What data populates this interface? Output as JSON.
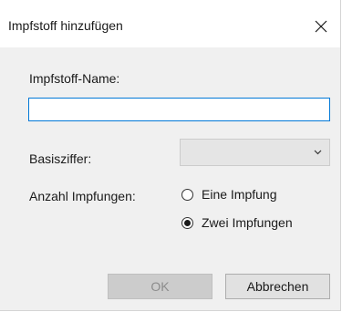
{
  "dialog": {
    "title": "Impfstoff hinzufügen",
    "close_icon": "close-icon"
  },
  "form": {
    "name_label": "Impfstoff-Name:",
    "name_value": "",
    "basis_label": "Basisziffer:",
    "basis_value": "",
    "count_label": "Anzahl Impfungen:",
    "options": [
      {
        "label": "Eine Impfung",
        "checked": false
      },
      {
        "label": "Zwei Impfungen",
        "checked": true
      }
    ]
  },
  "buttons": {
    "ok_label": "OK",
    "ok_enabled": false,
    "cancel_label": "Abbrechen"
  },
  "colors": {
    "focus_border": "#0078d7",
    "dialog_bg": "#f0f0f0"
  }
}
